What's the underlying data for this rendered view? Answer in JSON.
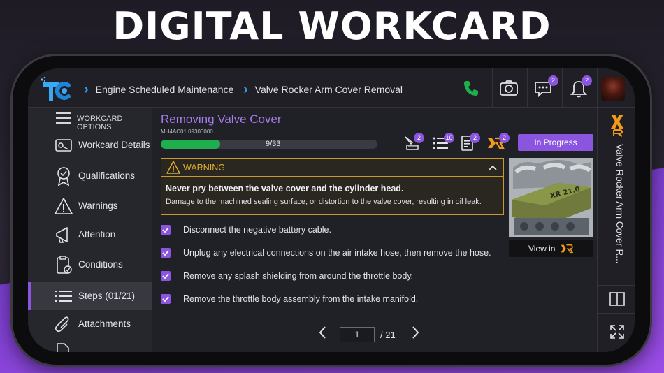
{
  "headline": "DIGITAL WORKCARD",
  "breadcrumb": [
    "Engine Scheduled Maintenance",
    "Valve Rocker Arm Cover Removal"
  ],
  "header": {
    "chat_badge": "2",
    "notifications_badge": "2"
  },
  "sidebar": {
    "options_label": "WORKCARD OPTIONS",
    "items": [
      {
        "label": "Workcard Details",
        "icon": "wrench-card-icon"
      },
      {
        "label": "Qualifications",
        "icon": "badge-icon"
      },
      {
        "label": "Warnings",
        "icon": "warning-icon"
      },
      {
        "label": "Attention",
        "icon": "megaphone-icon"
      },
      {
        "label": "Conditions",
        "icon": "clipboard-check-icon"
      },
      {
        "label": "Steps (01/21)",
        "icon": "list-icon"
      },
      {
        "label": "Attachments",
        "icon": "paperclip-icon"
      }
    ]
  },
  "main": {
    "title": "Removing Valve Cover",
    "code": "MH4AC01.09300000",
    "progress": {
      "current": 9,
      "total": 33,
      "text": "9/33"
    },
    "toolbar_badges": {
      "tools": "2",
      "checklist": "10",
      "documents": "2",
      "xr": "2"
    },
    "status": "In Progress",
    "warning": {
      "label": "WARNING",
      "headline": "Never pry between the valve cover and the cylinder head.",
      "text": "Damage to the machined sealing surface, or distortion to the valve cover, resulting in oil leak."
    },
    "steps": [
      "Disconnect the negative battery cable.",
      "Unplug any electrical connections on the air intake hose, then remove the hose.",
      "Remove any splash shielding from around the throttle body.",
      "Remove the throttle body assembly from the intake manifold."
    ],
    "xr": {
      "image_label": "XR 21.0",
      "view_label": "View in",
      "view_brand": "XR"
    },
    "pagination": {
      "page": "1",
      "total": "/ 21"
    }
  },
  "rail": {
    "title": "Valve Rocker Arm Cover R..."
  },
  "colors": {
    "accent": "#8b55e0",
    "link": "#2f9ef2",
    "success": "#1fae4e",
    "warning": "#e5b031",
    "xr_orange": "#f29a1a"
  }
}
